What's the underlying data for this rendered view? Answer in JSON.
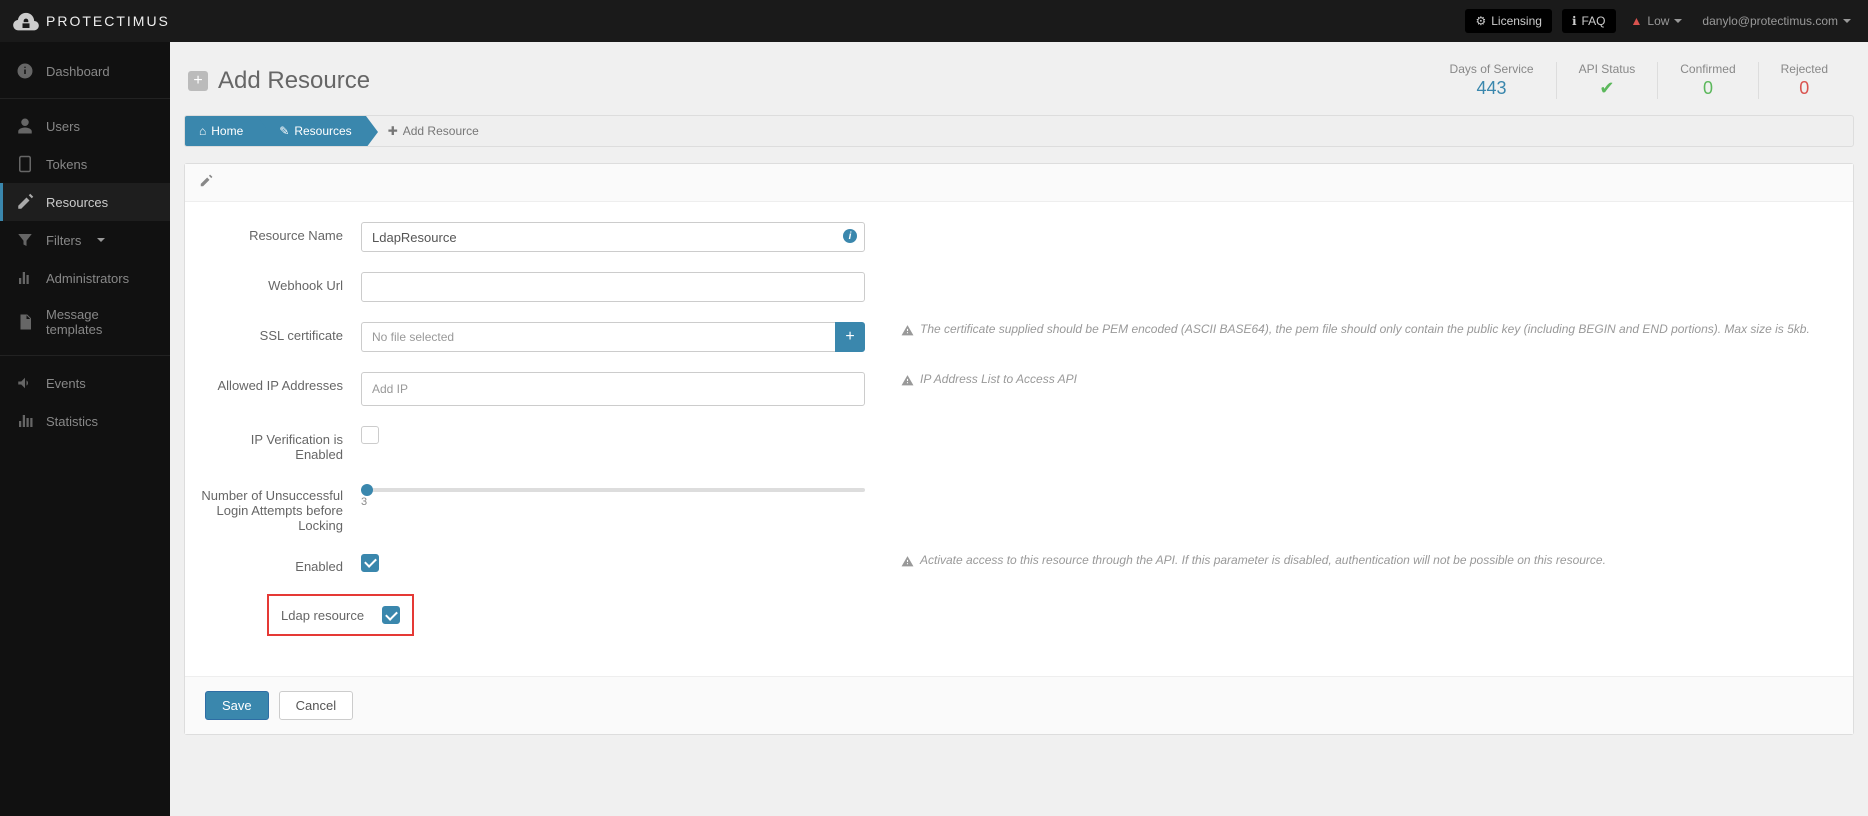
{
  "brand": "PROTECTIMUS",
  "topbar": {
    "licensing": "Licensing",
    "faq": "FAQ",
    "level": "Low",
    "email": "danylo@protectimus.com"
  },
  "sidebar": {
    "items": [
      {
        "label": "Dashboard",
        "icon": "gauge"
      },
      {
        "label": "Users",
        "icon": "user"
      },
      {
        "label": "Tokens",
        "icon": "tablet"
      },
      {
        "label": "Resources",
        "icon": "edit",
        "active": true
      },
      {
        "label": "Filters",
        "icon": "filter",
        "caret": true
      },
      {
        "label": "Administrators",
        "icon": "bars"
      },
      {
        "label": "Message templates",
        "icon": "file"
      },
      {
        "label": "Events",
        "icon": "bullhorn"
      },
      {
        "label": "Statistics",
        "icon": "chart"
      }
    ]
  },
  "page": {
    "title": "Add Resource"
  },
  "stats": {
    "days_label": "Days of Service",
    "days_value": "443",
    "api_label": "API Status",
    "confirmed_label": "Confirmed",
    "confirmed_value": "0",
    "rejected_label": "Rejected",
    "rejected_value": "0"
  },
  "breadcrumb": {
    "home": "Home",
    "resources": "Resources",
    "current": "Add Resource"
  },
  "form": {
    "resource_name_label": "Resource Name",
    "resource_name_value": "LdapResource",
    "webhook_label": "Webhook Url",
    "ssl_label": "SSL certificate",
    "ssl_placeholder": "No file selected",
    "ssl_hint": "The certificate supplied should be PEM encoded (ASCII BASE64), the pem file should only contain the public key (including BEGIN and END portions). Max size is 5kb.",
    "ip_label": "Allowed IP Addresses",
    "ip_placeholder": "Add IP",
    "ip_hint": "IP Address List to Access API",
    "ipverify_label": "IP Verification is Enabled",
    "attempts_label": "Number of Unsuccessful Login Attempts before Locking",
    "attempts_value": "3",
    "enabled_label": "Enabled",
    "enabled_hint": "Activate access to this resource through the API. If this parameter is disabled, authentication will not be possible on this resource.",
    "ldap_label": "Ldap resource"
  },
  "buttons": {
    "save": "Save",
    "cancel": "Cancel"
  }
}
